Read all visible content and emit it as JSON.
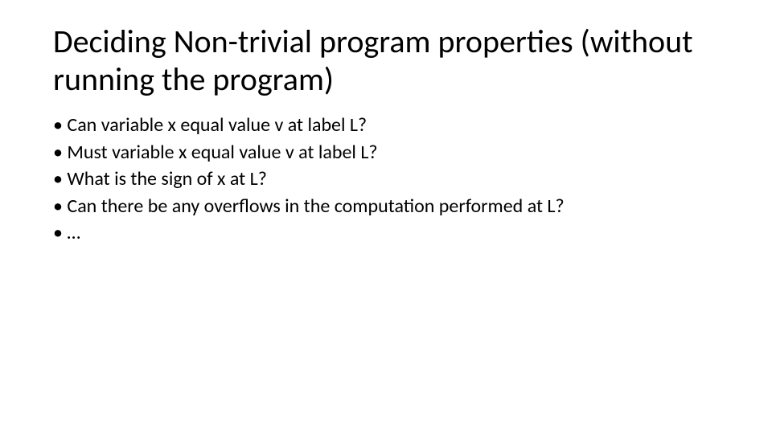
{
  "title": "Deciding Non-trivial program properties (without running the program)",
  "bullets": [
    "Can variable x equal value v at label L?",
    "Must variable x equal value v at label L?",
    "What is the sign of x at L?",
    "Can there be any overflows in the computation performed at L?",
    "…"
  ]
}
